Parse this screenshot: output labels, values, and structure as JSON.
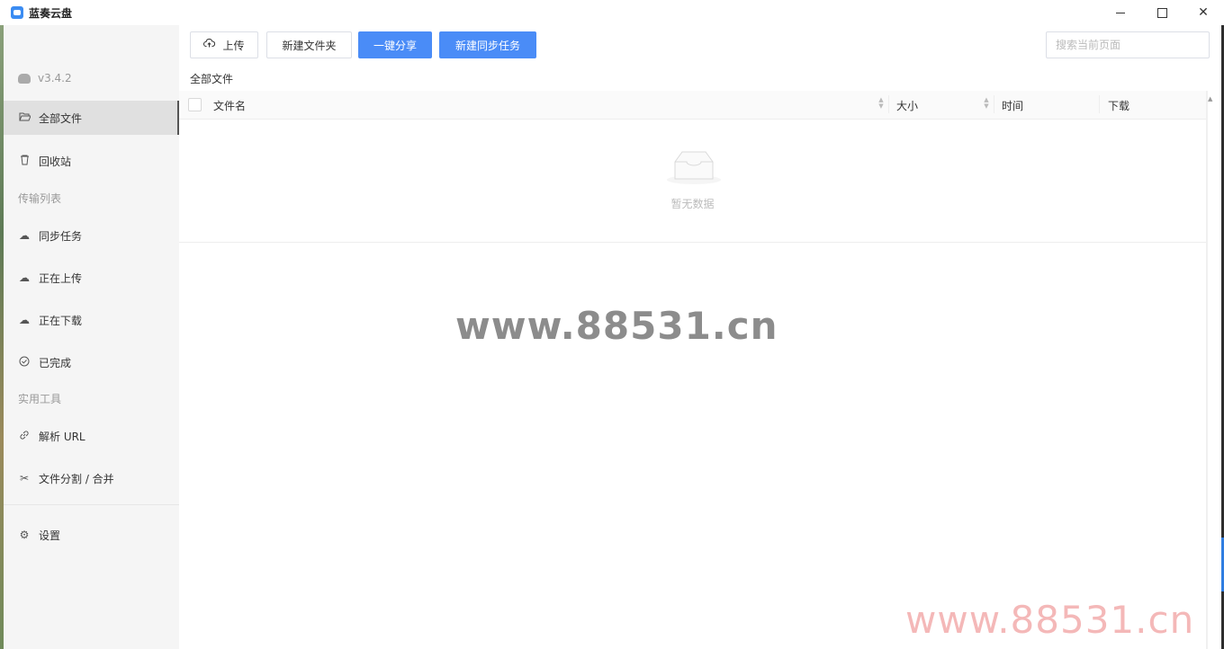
{
  "window": {
    "title": "蓝奏云盘",
    "controls": {
      "minimize": "—",
      "maximize": "□",
      "close": "✕"
    }
  },
  "sidebar": {
    "version": "v3.4.2",
    "items": [
      {
        "label": "全部文件",
        "icon": "folder-open-icon"
      },
      {
        "label": "回收站",
        "icon": "trash-icon"
      }
    ],
    "section_transfer": "传输列表",
    "transfer_items": [
      {
        "label": "同步任务",
        "icon": "cloud-sync-icon"
      },
      {
        "label": "正在上传",
        "icon": "cloud-upload-icon"
      },
      {
        "label": "正在下载",
        "icon": "cloud-download-icon"
      },
      {
        "label": "已完成",
        "icon": "check-circle-icon"
      }
    ],
    "section_tools": "实用工具",
    "tool_items": [
      {
        "label": "解析 URL",
        "icon": "link-icon"
      },
      {
        "label": "文件分割 / 合并",
        "icon": "scissors-icon"
      }
    ],
    "settings": {
      "label": "设置",
      "icon": "gear-icon"
    }
  },
  "toolbar": {
    "upload": "上传",
    "new_folder": "新建文件夹",
    "one_click_share": "一键分享",
    "new_sync_task": "新建同步任务"
  },
  "search": {
    "placeholder": "搜索当前页面",
    "value": ""
  },
  "breadcrumb": "全部文件",
  "table": {
    "columns": [
      "文件名",
      "大小",
      "时间",
      "下载"
    ],
    "rows": [],
    "empty_text": "暂无数据"
  },
  "watermark": {
    "text": "www.88531.cn"
  },
  "colors": {
    "primary": "#4a8cf7",
    "sidebar_bg": "#f5f5f5",
    "active_bg": "#e0e0e0"
  }
}
